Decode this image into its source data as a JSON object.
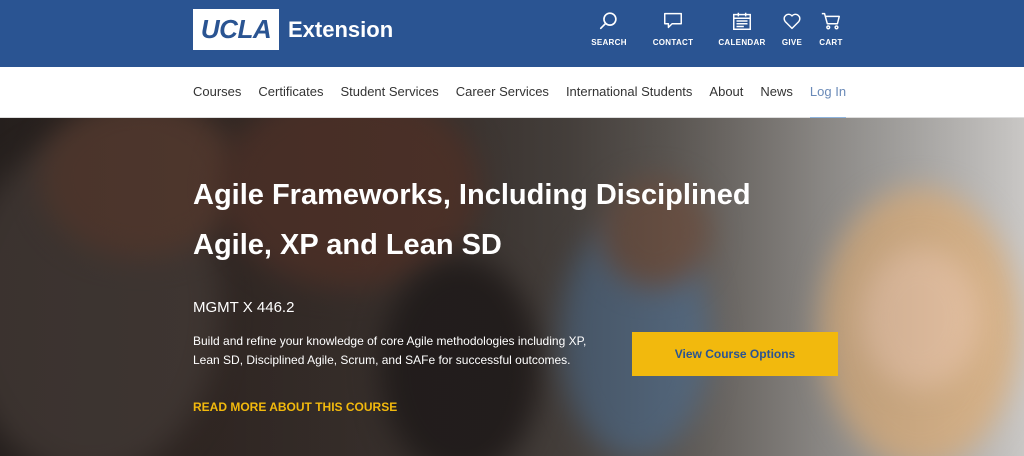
{
  "header": {
    "logo_text": "UCLA",
    "logo_sub": "Extension",
    "utilities": [
      {
        "label": "SEARCH",
        "icon": "search-icon"
      },
      {
        "label": "CONTACT",
        "icon": "chat-icon"
      },
      {
        "label": "CALENDAR",
        "icon": "calendar-icon"
      },
      {
        "label": "GIVE",
        "icon": "heart-icon"
      },
      {
        "label": "CART",
        "icon": "cart-icon"
      }
    ]
  },
  "nav": {
    "items": [
      "Courses",
      "Certificates",
      "Student Services",
      "Career Services",
      "International Students",
      "About",
      "News",
      "Log In"
    ]
  },
  "hero": {
    "title": "Agile Frameworks, Including Disciplined Agile, XP and Lean SD",
    "course_code": "MGMT X 446.2",
    "description": "Build and refine your knowledge of core Agile methodologies including XP, Lean SD, Disciplined Agile, Scrum, and SAFe for successful outcomes.",
    "read_more": "READ MORE ABOUT THIS COURSE",
    "cta": "View Course Options"
  },
  "colors": {
    "brand_blue": "#2a5492",
    "accent_gold": "#f2b90d"
  }
}
